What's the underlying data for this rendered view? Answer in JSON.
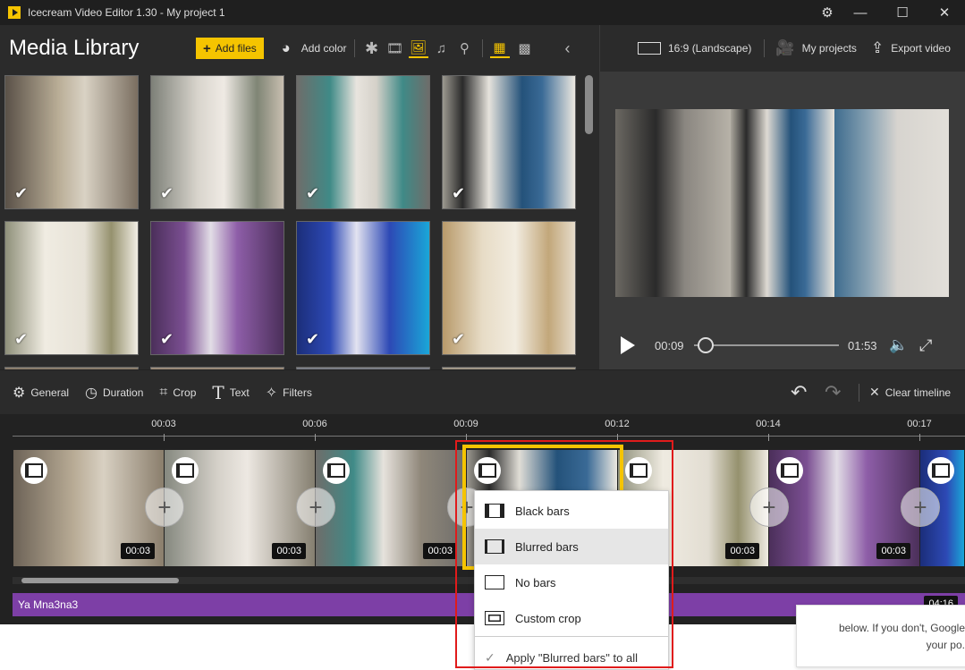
{
  "window": {
    "title": "Icecream Video Editor 1.30 - My project 1",
    "minimize_glyph": "—",
    "maximize_glyph": "☐",
    "close_glyph": "✕"
  },
  "library": {
    "title": "Media Library",
    "add_files_label": "Add files",
    "add_color_label": "Add color"
  },
  "right_header": {
    "aspect_label": "16:9 (Landscape)",
    "my_projects_label": "My projects",
    "export_label": "Export video"
  },
  "media_items": [
    {
      "checked": true
    },
    {
      "checked": true
    },
    {
      "checked": true
    },
    {
      "checked": true
    },
    {
      "checked": true
    },
    {
      "checked": true
    },
    {
      "checked": true
    },
    {
      "checked": true
    }
  ],
  "player": {
    "current_time": "00:09",
    "total_time": "01:53",
    "progress": 0.08
  },
  "tools": {
    "general": "General",
    "duration": "Duration",
    "crop": "Crop",
    "text": "Text",
    "filters": "Filters",
    "clear_timeline": "Clear timeline"
  },
  "timeline": {
    "ruler": [
      "00:03",
      "00:06",
      "00:09",
      "00:12",
      "00:14",
      "00:17"
    ],
    "clips": [
      {
        "duration": "00:03"
      },
      {
        "duration": "00:03"
      },
      {
        "duration": "00:03"
      },
      {
        "duration": ""
      },
      {
        "duration": "00:03"
      },
      {
        "duration": "00:03"
      },
      {
        "duration": ""
      }
    ],
    "audio_track": {
      "name": "Ya Mna3na3",
      "duration": "04:16"
    }
  },
  "context_menu": {
    "items": [
      "Black bars",
      "Blurred bars",
      "No bars",
      "Custom crop"
    ],
    "selected": "Blurred bars",
    "apply_label": "Apply \"Blurred bars\" to all"
  },
  "google_card": {
    "line1": "below. If you don't, Google",
    "line2": ".your po"
  },
  "colors": {
    "accent": "#f5c400",
    "audio_track": "#7d3fa6",
    "highlight_box": "#e01b1b"
  }
}
